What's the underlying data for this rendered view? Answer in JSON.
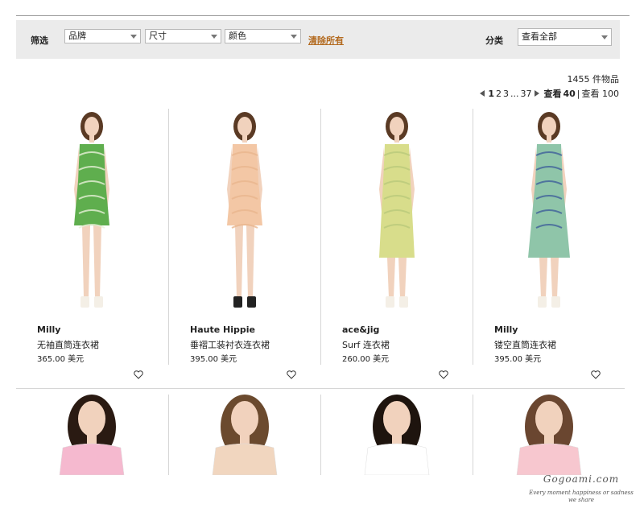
{
  "filters": {
    "label": "筛选",
    "brand_select": "品牌",
    "size_select": "尺寸",
    "color_select": "颜色",
    "clear_link": "清除所有",
    "sort_label": "分类",
    "sort_select": "查看全部"
  },
  "results": {
    "count": "1455 件物品",
    "pages": [
      "1",
      "2",
      "3",
      "...",
      "37"
    ],
    "view_prefix": "查看",
    "view_40": "40",
    "view_sep": "|",
    "view_100": "查看 100"
  },
  "products": [
    {
      "brand": "Milly",
      "name": "无袖直筒连衣裙",
      "price": "365.00 美元",
      "dress_color": "#5fae4e",
      "accent": "#e7f0d8"
    },
    {
      "brand": "Haute Hippie",
      "name": "垂褶工装衬衣连衣裙",
      "price": "395.00 美元",
      "dress_color": "#f3c7a5",
      "accent": "#e9b58d"
    },
    {
      "brand": "ace&jig",
      "name": "Surf 连衣裙",
      "price": "260.00 美元",
      "dress_color": "#d8dd8b",
      "accent": "#b9c97a"
    },
    {
      "brand": "Milly",
      "name": "镂空直筒连衣裙",
      "price": "395.00 美元",
      "dress_color": "#8fc5a9",
      "accent": "#3f5f9a"
    }
  ],
  "row2_products": [
    {
      "top_color": "#f5b9cf",
      "hair": "#2a1a12"
    },
    {
      "top_color": "#f1d6bf",
      "hair": "#6b4a2e"
    },
    {
      "top_color": "#ffffff",
      "hair": "#1e140e"
    },
    {
      "top_color": "#f7c7cf",
      "hair": "#6a4630"
    }
  ],
  "watermark": {
    "line1": "Gogoami.com",
    "line2": "Every moment happiness or sadness",
    "line3": "we share"
  },
  "icons": {
    "heart": "heart-icon",
    "caret": "chevron-down-icon"
  }
}
